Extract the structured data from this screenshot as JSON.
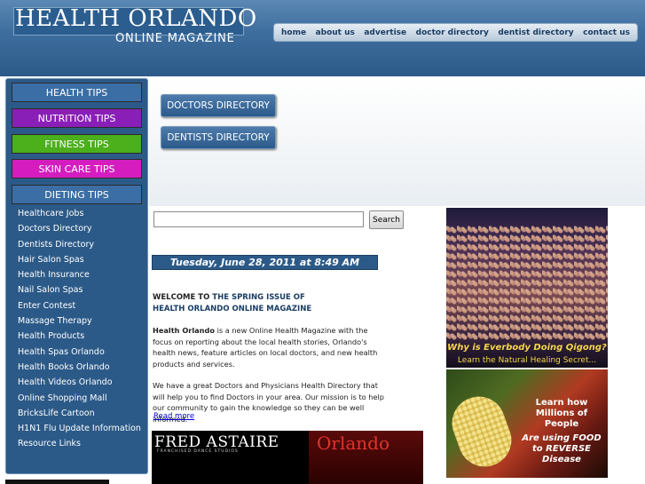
{
  "header": {
    "title": "HEALTH ORLANDO",
    "subtitle": "ONLINE MAGAZINE",
    "nav": [
      "home",
      "about us",
      "advertise",
      "doctor directory",
      "dentist directory",
      "contact us"
    ]
  },
  "sidebar": {
    "tips": [
      {
        "label": "HEALTH TIPS",
        "color": "#3b6ea5"
      },
      {
        "label": "NUTRITION TIPS",
        "color": "#8a1fb7"
      },
      {
        "label": "FITNESS TIPS",
        "color": "#4caf1c"
      },
      {
        "label": "SKIN CARE TIPS",
        "color": "#d51dbf"
      },
      {
        "label": "DIETING TIPS",
        "color": "#3b6ea5"
      }
    ],
    "links": [
      "Healthcare Jobs",
      "Doctors Directory",
      "Dentists Directory",
      "Hair Salon Spas",
      "Health Insurance",
      "Nail Salon Spas",
      "Enter Contest",
      "Massage Therapy",
      "Health Products",
      "Health Spas Orlando",
      "Health Books Orlando",
      "Health Videos Orlando",
      "Online Shopping Mall",
      "BricksLife Cartoon",
      "H1N1 Flu Update Information",
      "Resource Links"
    ]
  },
  "directories": {
    "doctors": "DOCTORS DIRECTORY",
    "dentists": "DENTISTS DIRECTORY"
  },
  "search": {
    "value": "",
    "button": "Search"
  },
  "date": "Tuesday, June 28, 2011 at 8:49 AM",
  "welcome": {
    "prefix": "WELCOME TO ",
    "line1": "THE SPRING ISSUE OF",
    "line2": "HEALTH ORLANDO ONLINE MAGAZINE"
  },
  "intro": {
    "brand": "Health Orlando",
    "text": " is a new Online Health Magazine with the focus on reporting about the local health stories, Orlando's health news, feature articles on local doctors, and new health products and services."
  },
  "para2": "We have a great Doctors and Physicians Health Directory that will help you to find Doctors in your area. Our mission is to help our community to gain the knowledge so they can be well informed.",
  "read_more": "Read more",
  "ads": {
    "fred": {
      "title": "FRED ASTAIRE",
      "sub": "FRANCHISED DANCE STUDIOS",
      "city": "Orlando"
    },
    "qigong": {
      "line1": "Why is Everbody Doing Qigong?",
      "line2": "Learn the Natural Healing Secret..."
    },
    "food": {
      "l1": "Learn how",
      "l2": "Millions of People",
      "l3": "Are using FOOD",
      "l4": "to REVERSE Disease"
    }
  }
}
